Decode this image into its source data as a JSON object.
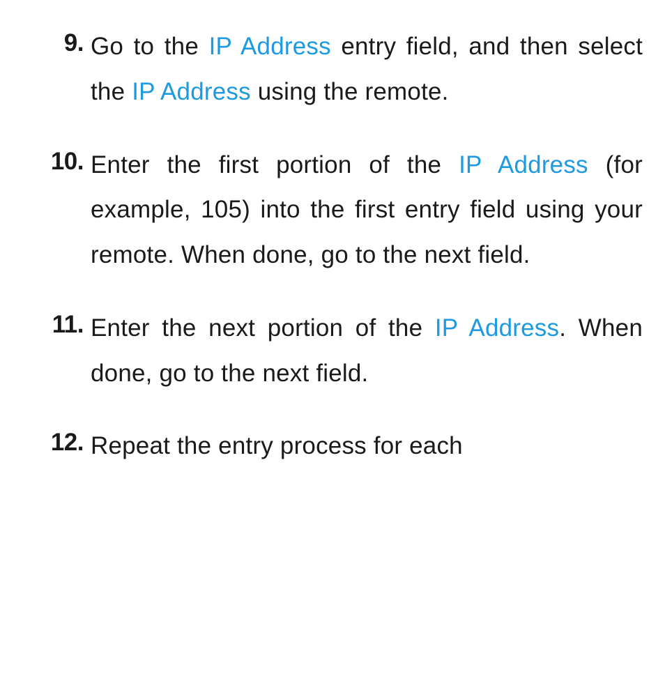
{
  "colors": {
    "link": "#1d9ae0",
    "text": "#1a1a1a"
  },
  "steps": [
    {
      "number": "9.",
      "fragments": [
        {
          "text": "Go to the "
        },
        {
          "text": "IP Address",
          "term": true
        },
        {
          "text": " entry field, and then select the "
        },
        {
          "text": "IP Address",
          "term": true
        },
        {
          "text": " using the remote."
        }
      ]
    },
    {
      "number": "10.",
      "fragments": [
        {
          "text": "Enter the first portion of the "
        },
        {
          "text": "IP Address",
          "term": true
        },
        {
          "text": " (for example, 105) into the first entry field using your remote. When done, go to the next field."
        }
      ]
    },
    {
      "number": "11.",
      "fragments": [
        {
          "text": "Enter the next portion of the "
        },
        {
          "text": "IP Address",
          "term": true
        },
        {
          "text": ". When done, go to the next field."
        }
      ]
    },
    {
      "number": "12.",
      "fragments": [
        {
          "text": "Repeat the entry process for each"
        }
      ]
    }
  ]
}
